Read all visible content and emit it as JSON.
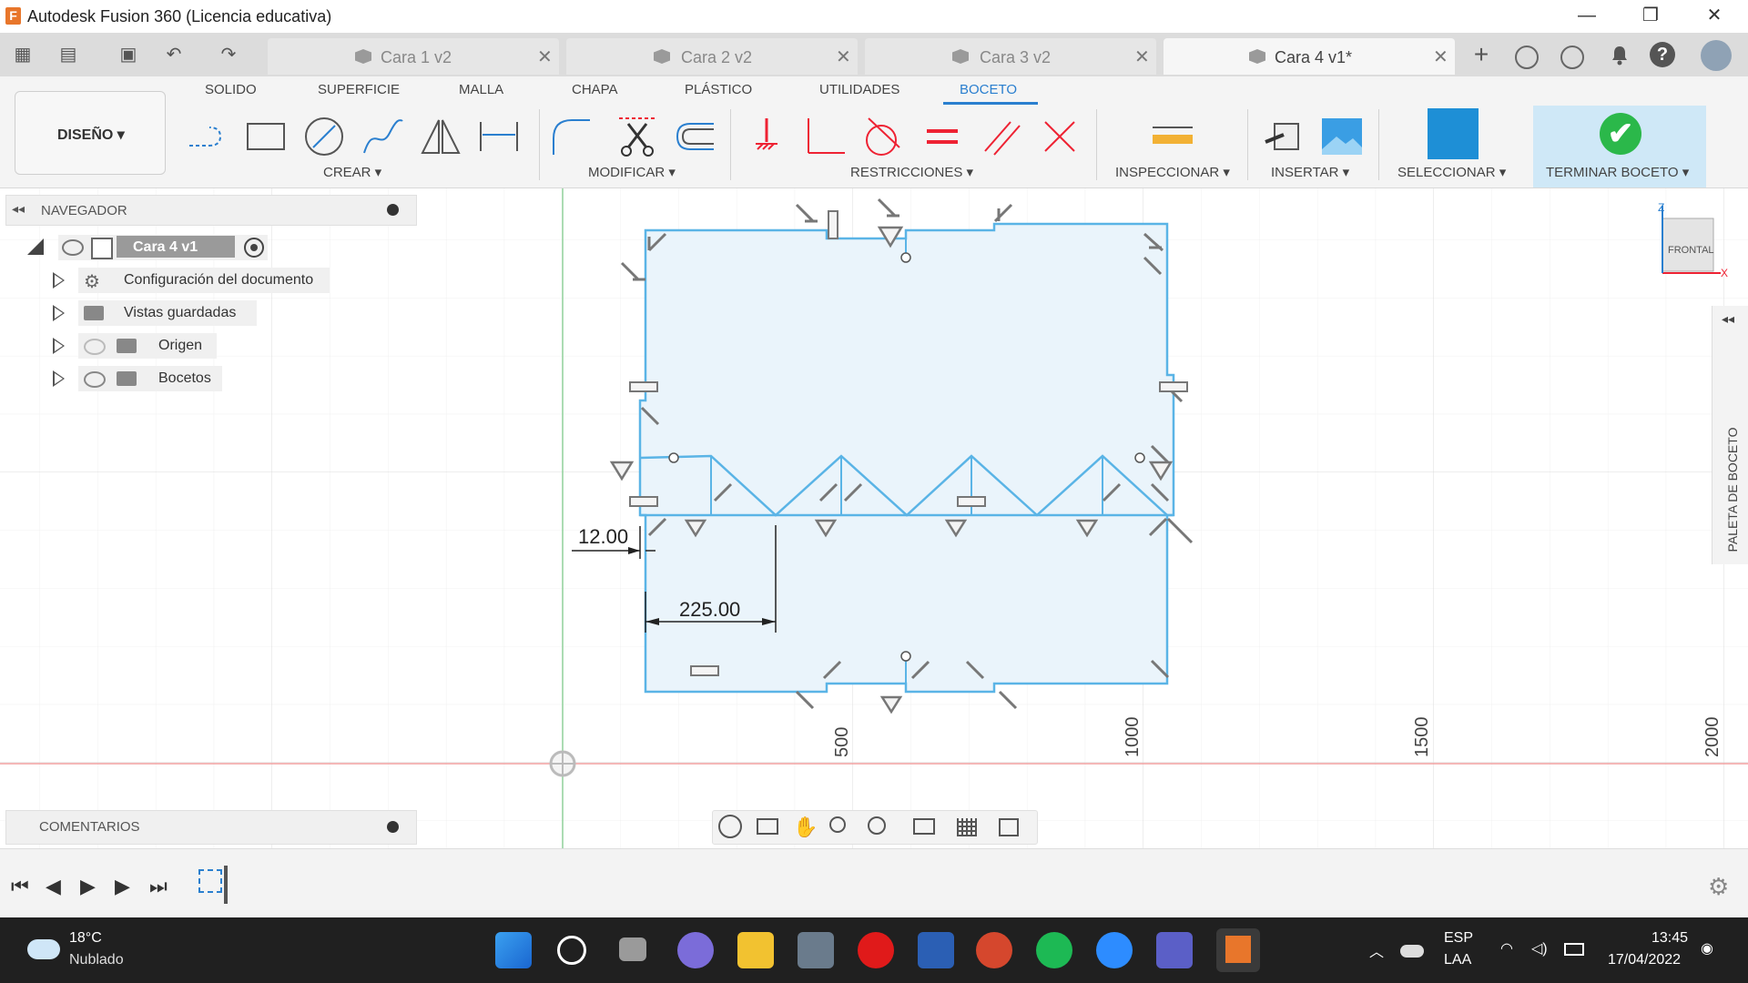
{
  "window": {
    "title": "Autodesk Fusion 360 (Licencia educativa)",
    "logo": "F",
    "minimize": "—",
    "maximize": "❐",
    "close": "✕"
  },
  "tabs": [
    {
      "label": "Cara 1 v2",
      "active": false
    },
    {
      "label": "Cara 2 v2",
      "active": false
    },
    {
      "label": "Cara 3 v2",
      "active": false
    },
    {
      "label": "Cara 4 v1*",
      "active": true
    }
  ],
  "tab_close": "✕",
  "quick": {
    "grid": "▦",
    "file": "▤",
    "save": "▣",
    "undo": "↶",
    "redo": "↷",
    "add": "+"
  },
  "ribbon": {
    "tabs": [
      "SOLIDO",
      "SUPERFICIE",
      "MALLA",
      "CHAPA",
      "PLÁSTICO",
      "UTILIDADES",
      "BOCETO"
    ],
    "active_tab": "BOCETO",
    "workspace": "DISEÑO ▾",
    "groups": {
      "crear": "CREAR ▾",
      "modificar": "MODIFICAR ▾",
      "restricciones": "RESTRICCIONES ▾",
      "inspeccionar": "INSPECCIONAR ▾",
      "insertar": "INSERTAR ▾",
      "seleccionar": "SELECCIONAR ▾",
      "terminar": "TERMINAR BOCETO ▾"
    },
    "finish_check": "✔"
  },
  "navigator": {
    "title": "NAVEGADOR",
    "root": "Cara 4 v1",
    "items": [
      "Configuración del documento",
      "Vistas guardadas",
      "Origen",
      "Bocetos"
    ]
  },
  "comments": "COMENTARIOS",
  "palette": "PALETA DE BOCETO",
  "viewcube": {
    "label": "FRONTAL",
    "z": "Z",
    "x": "X"
  },
  "sketch": {
    "dimensions": [
      "12.00",
      "225.00"
    ],
    "axis_ticks": [
      "500",
      "1000",
      "1500",
      "2000"
    ]
  },
  "taskbar": {
    "weather_temp": "18°C",
    "weather_desc": "Nublado",
    "lang1": "ESP",
    "lang2": "LAA",
    "time": "13:45",
    "date": "17/04/2022"
  },
  "colors": {
    "accent": "#2a7fcf",
    "sketch_line": "#5ab4e6",
    "sketch_fill": "#eaf4fb",
    "taskbar": "#202020"
  }
}
